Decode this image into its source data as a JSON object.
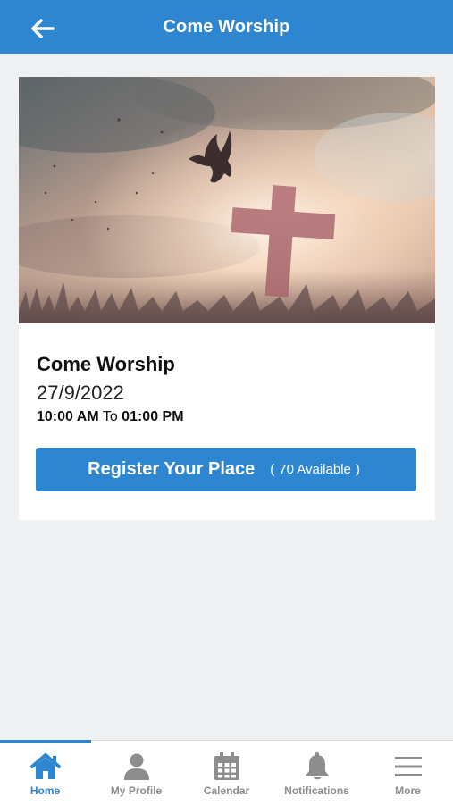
{
  "header": {
    "title": "Come Worship",
    "back_icon": "arrow-left-icon"
  },
  "event": {
    "title": "Come Worship",
    "date": "27/9/2022",
    "start_time": "10:00 AM",
    "to_label": "To",
    "end_time": "01:00 PM",
    "image_icon": "dove-and-cross-image"
  },
  "register": {
    "label": "Register Your Place",
    "open_paren": "(",
    "available": "70 Available",
    "close_paren": ")"
  },
  "bottom_nav": {
    "items": [
      {
        "label": "Home",
        "icon": "home-icon",
        "active": true
      },
      {
        "label": "My Profile",
        "icon": "user-icon",
        "active": false
      },
      {
        "label": "Calendar",
        "icon": "calendar-icon",
        "active": false
      },
      {
        "label": "Notifications",
        "icon": "bell-icon",
        "active": false
      },
      {
        "label": "More",
        "icon": "menu-icon",
        "active": false
      }
    ]
  },
  "colors": {
    "accent": "#2f86d0",
    "background": "#eef0f1",
    "inactive_nav": "#8d8d8d"
  }
}
